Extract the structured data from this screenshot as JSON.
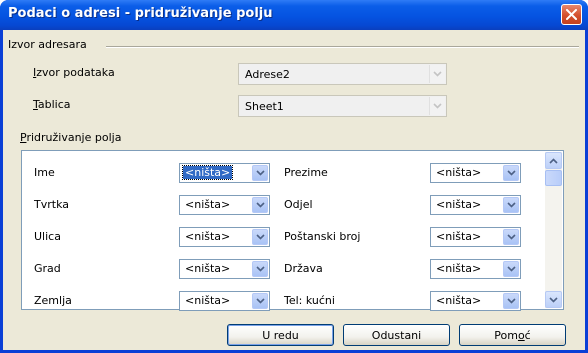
{
  "window": {
    "title": "Podaci o adresi - pridruživanje polju"
  },
  "source_group": {
    "label": "Izvor adresara",
    "data_source": {
      "label": "Izvor podataka",
      "value": "Adrese2"
    },
    "table": {
      "label": "Tablica",
      "value": "Sheet1"
    }
  },
  "mapping_group": {
    "label": "Pridruživanje polja",
    "rows": [
      {
        "left_label": "Ime",
        "left_value": "<ništa>",
        "right_label": "Prezime",
        "right_value": "<ništa>"
      },
      {
        "left_label": "Tvrtka",
        "left_value": "<ništa>",
        "right_label": "Odjel",
        "right_value": "<ništa>"
      },
      {
        "left_label": "Ulica",
        "left_value": "<ništa>",
        "right_label": "Poštanski broj",
        "right_value": "<ništa>"
      },
      {
        "left_label": "Grad",
        "left_value": "<ništa>",
        "right_label": "Država",
        "right_value": "<ništa>"
      },
      {
        "left_label": "Zemlja",
        "left_value": "<ništa>",
        "right_label": "Tel: kućni",
        "right_value": "<ništa>"
      }
    ]
  },
  "buttons": {
    "ok": "U redu",
    "cancel": "Odustani",
    "help": "Pomoć"
  },
  "colors": {
    "title_bar": "#0553e1",
    "dialog_bg": "#ece9d8",
    "selection": "#316ac5",
    "close_button": "#d4502d"
  }
}
